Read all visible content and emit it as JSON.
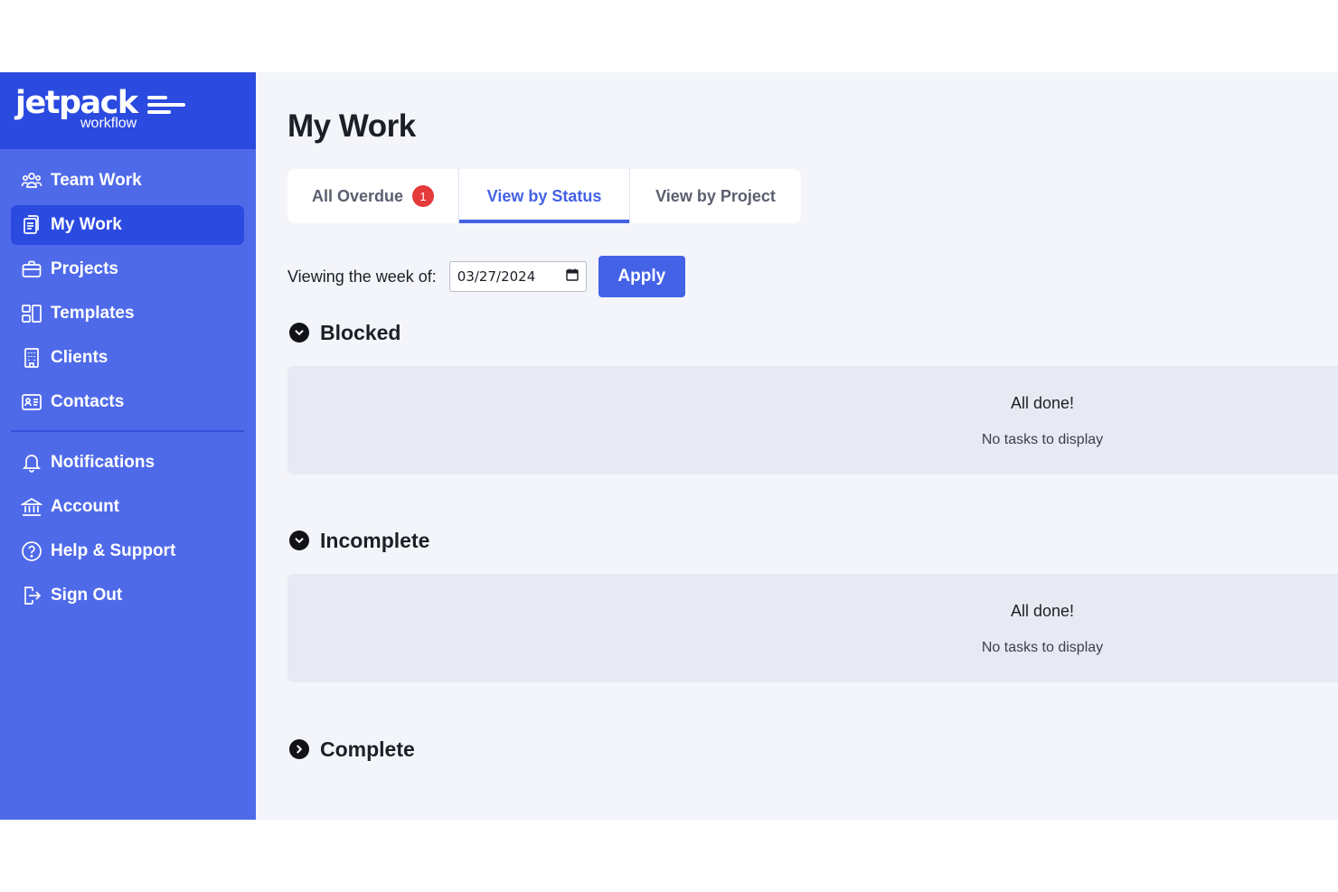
{
  "brand": {
    "name": "jetpack",
    "tagline": "workflow"
  },
  "sidebar": {
    "items": [
      {
        "label": "Team Work",
        "icon": "team-icon"
      },
      {
        "label": "My Work",
        "icon": "clipboard-icon",
        "active": true
      },
      {
        "label": "Projects",
        "icon": "briefcase-icon"
      },
      {
        "label": "Templates",
        "icon": "templates-icon"
      },
      {
        "label": "Clients",
        "icon": "building-icon"
      },
      {
        "label": "Contacts",
        "icon": "contact-card-icon"
      }
    ],
    "secondary_items": [
      {
        "label": "Notifications",
        "icon": "bell-icon"
      },
      {
        "label": "Account",
        "icon": "bank-icon"
      },
      {
        "label": "Help & Support",
        "icon": "help-icon"
      },
      {
        "label": "Sign Out",
        "icon": "sign-out-icon"
      }
    ]
  },
  "page": {
    "title": "My Work"
  },
  "tabs": [
    {
      "label": "All Overdue",
      "badge": "1"
    },
    {
      "label": "View by Status",
      "active": true
    },
    {
      "label": "View by Project"
    }
  ],
  "week_filter": {
    "label": "Viewing the week of:",
    "value": "03/27/2024",
    "apply_label": "Apply"
  },
  "sections": [
    {
      "title": "Blocked",
      "expanded": true,
      "empty_title": "All done!",
      "empty_subtitle": "No tasks to display"
    },
    {
      "title": "Incomplete",
      "expanded": true,
      "empty_title": "All done!",
      "empty_subtitle": "No tasks to display"
    },
    {
      "title": "Complete",
      "expanded": false
    }
  ],
  "colors": {
    "sidebar": "#4f6ae9",
    "sidebar_header": "#2b4ae0",
    "accent": "#4462e6",
    "badge": "#e53a3a",
    "background": "#f4f5fa",
    "panel": "#e7eaf3"
  }
}
